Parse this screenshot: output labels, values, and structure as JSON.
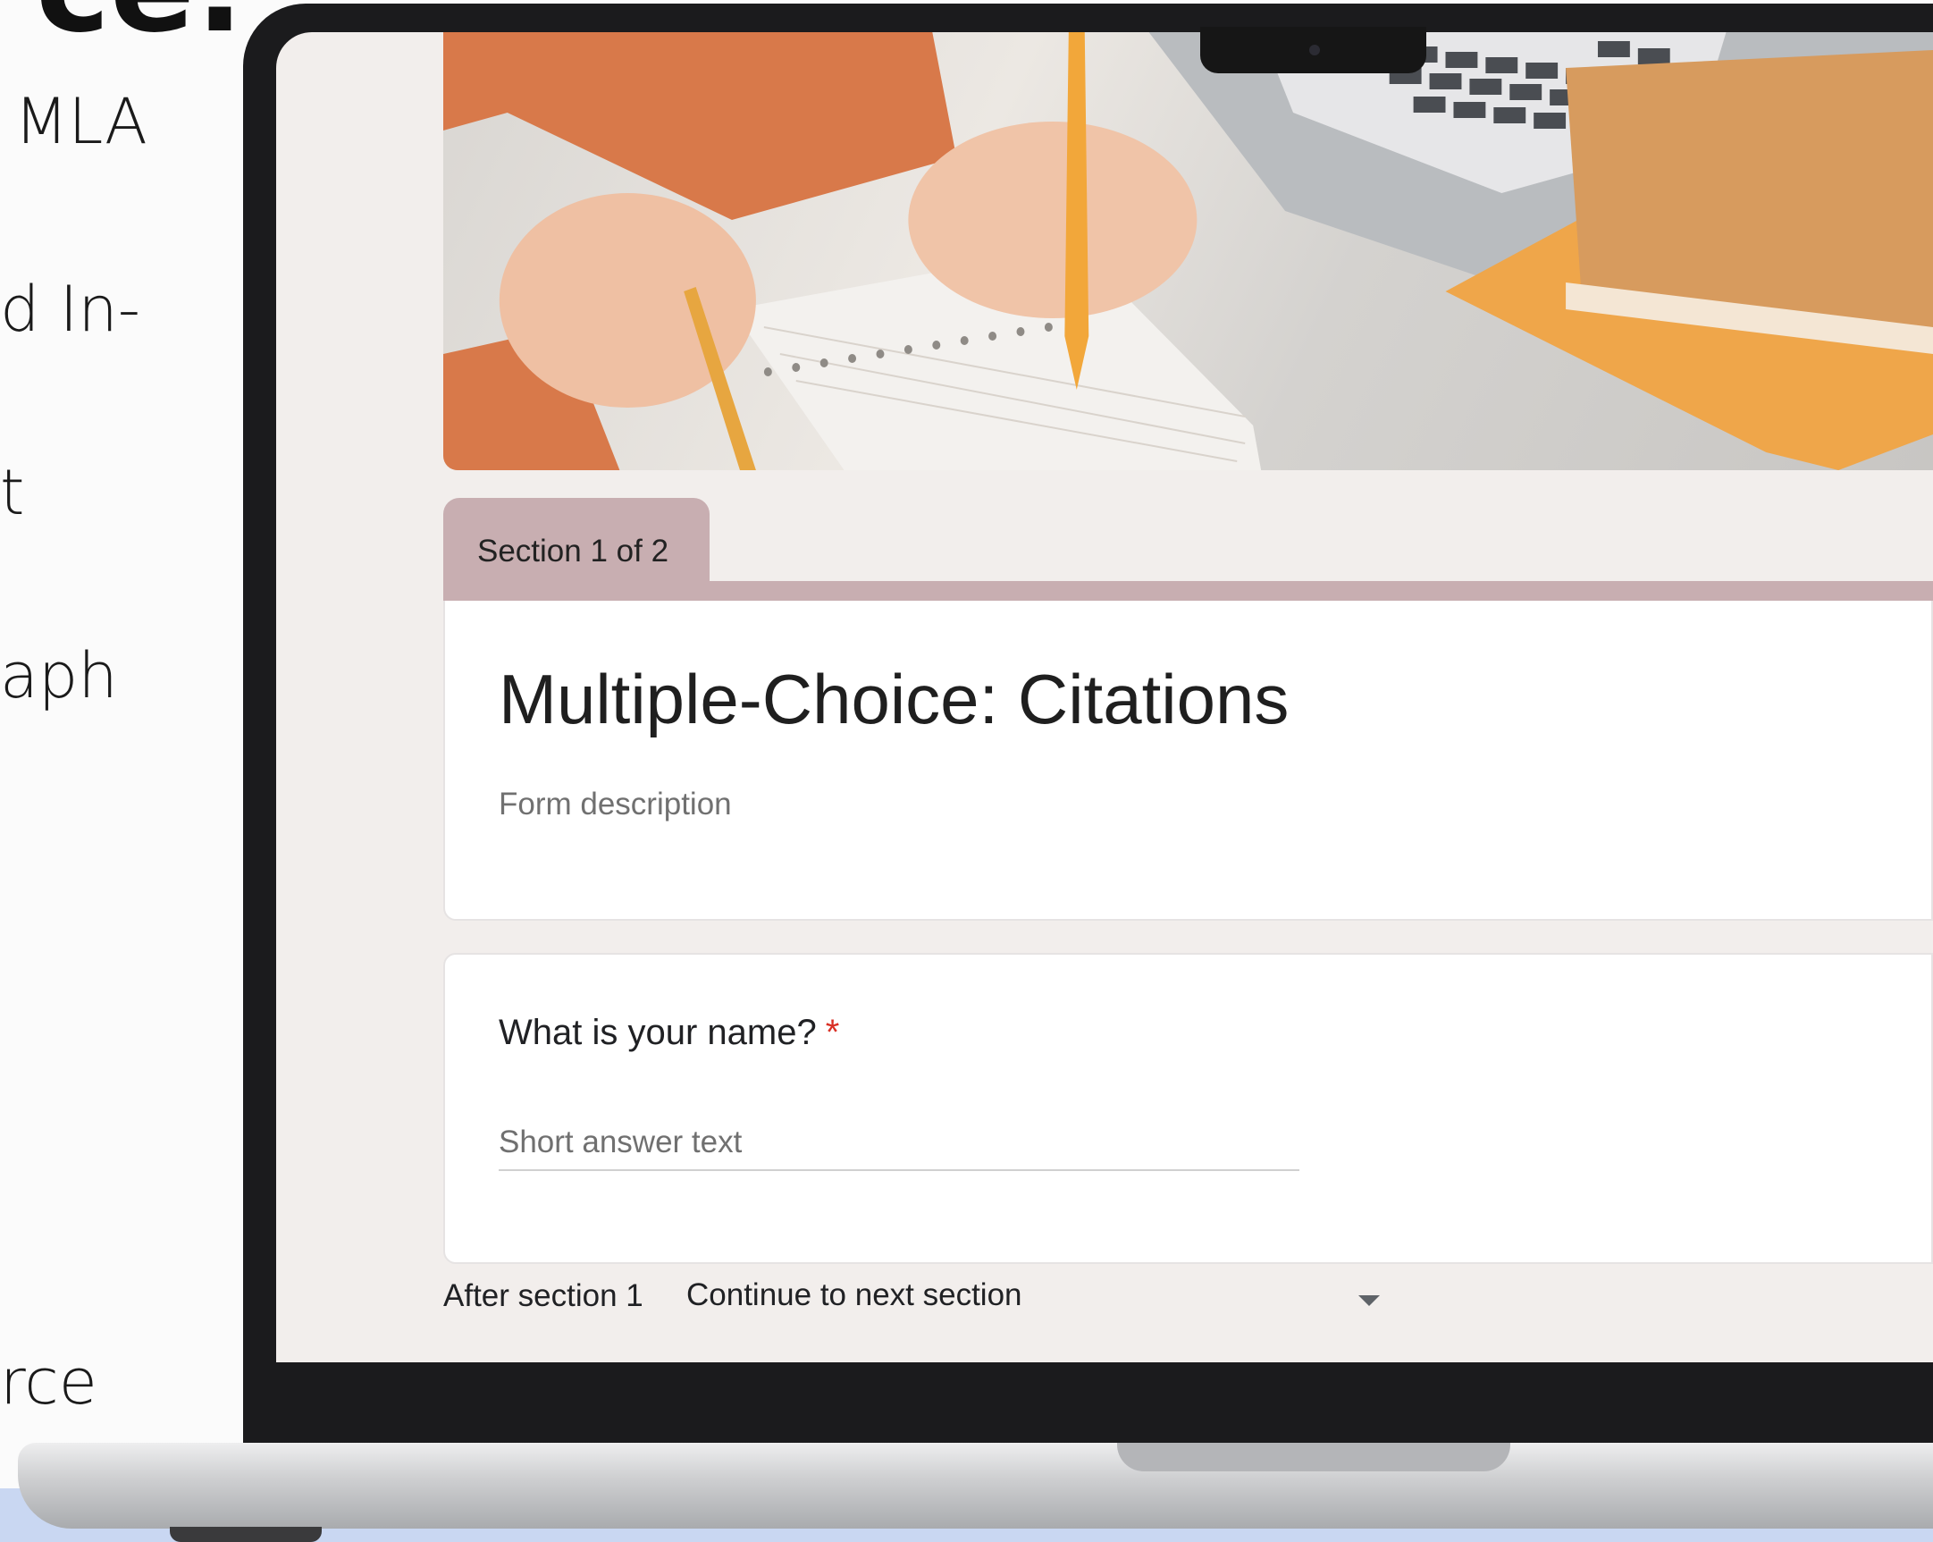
{
  "side_text": {
    "heading": "ce:",
    "lines": [
      "MLA",
      "d In-",
      "t",
      "aph",
      "rce"
    ]
  },
  "form": {
    "section_label": "Section 1 of 2",
    "title": "Multiple-Choice: Citations",
    "description_placeholder": "Form description",
    "question": {
      "label": "What is your name?",
      "required_mark": "*",
      "placeholder": "Short answer text"
    },
    "after_section": {
      "label": "After section 1",
      "selected": "Continue to next section"
    }
  },
  "colors": {
    "section_accent": "#c8aeb1",
    "required": "#d93025",
    "screen_background": "#f2eeec",
    "page_background": "#fbfbfb",
    "bottom_strip": "#c9d7f2"
  },
  "icons": [
    "dropdown-caret-icon",
    "camera-icon"
  ],
  "header_image": "photo of hands writing with a pencil in a spiral notebook beside a laptop and orange notebooks"
}
